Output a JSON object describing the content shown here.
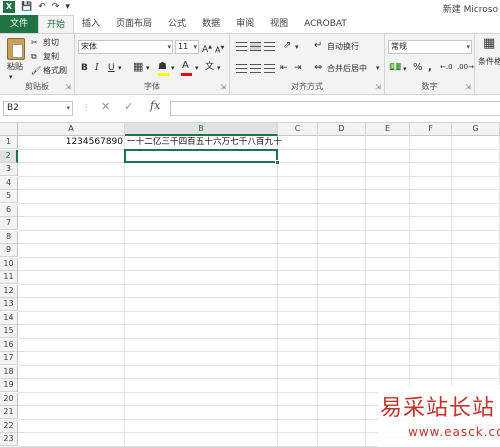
{
  "app": {
    "logo": "X",
    "title": "新建 Microso"
  },
  "tabs": [
    "文件",
    "开始",
    "插入",
    "页面布局",
    "公式",
    "数据",
    "审阅",
    "视图",
    "ACROBAT"
  ],
  "ribbon": {
    "clipboard": {
      "paste": "粘贴",
      "cut": "剪切",
      "copy": "复制",
      "format_painter": "格式刷",
      "label": "剪贴板"
    },
    "font": {
      "name": "宋体",
      "size": "11",
      "bold": "B",
      "italic": "I",
      "underline": "U",
      "label": "字体"
    },
    "alignment": {
      "wrap": "自动换行",
      "merge": "合并后居中",
      "label": "对齐方式"
    },
    "number": {
      "format": "常规",
      "label": "数字"
    },
    "styles": {
      "conditional": "条件格"
    }
  },
  "formula_bar": {
    "name_box": "B2",
    "fx": "fx",
    "value": ""
  },
  "columns": [
    "A",
    "B",
    "C",
    "D",
    "E",
    "F",
    "G"
  ],
  "rows": [
    "1",
    "2",
    "3",
    "4",
    "5",
    "6",
    "7",
    "8",
    "9",
    "10",
    "11",
    "12",
    "13",
    "14",
    "15",
    "16",
    "17",
    "18",
    "19",
    "20",
    "21",
    "22",
    "23"
  ],
  "cells": {
    "A1": "1234567890",
    "B1": "一十二亿三千四百五十六万七千八百九十"
  },
  "selected": {
    "cell": "B2",
    "column": "B",
    "row": "2"
  },
  "colors": {
    "accent": "#217346",
    "watermark": "#c0352b"
  },
  "watermark": {
    "main": "易采站长站",
    "sub": "www.easck.com"
  }
}
